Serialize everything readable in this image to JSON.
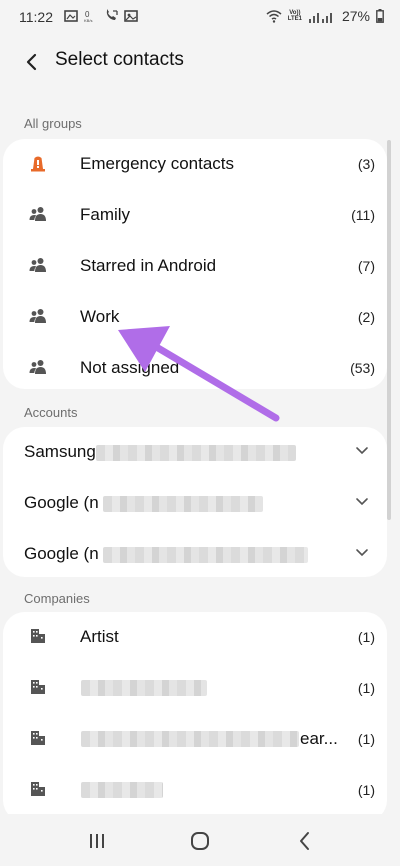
{
  "status_bar": {
    "time": "11:22",
    "volte": "Vo))",
    "lte": "LTE1",
    "battery": "27%"
  },
  "header": {
    "title": "Select contacts"
  },
  "sections": {
    "all_groups": "All groups",
    "accounts": "Accounts",
    "companies": "Companies"
  },
  "groups": [
    {
      "label": "Emergency contacts",
      "count": "(3)",
      "icon": "emergency-icon"
    },
    {
      "label": "Family",
      "count": "(11)",
      "icon": "group-icon"
    },
    {
      "label": "Starred in Android",
      "count": "(7)",
      "icon": "group-icon"
    },
    {
      "label": "Work",
      "count": "(2)",
      "icon": "group-icon"
    },
    {
      "label": "Not assigned",
      "count": "(53)",
      "icon": "group-icon"
    }
  ],
  "accounts": [
    {
      "label": "Samsung"
    },
    {
      "label": "Google (n"
    },
    {
      "label": "Google (n"
    }
  ],
  "companies": [
    {
      "label": "Artist",
      "count": "(1)"
    },
    {
      "label": "",
      "count": "(1)"
    },
    {
      "label": "ear...",
      "count": "(1)"
    },
    {
      "label": "",
      "count": "(1)"
    }
  ],
  "colors": {
    "accent_arrow": "#b06de8",
    "emergency": "#e86a2a",
    "icon_gray": "#555555"
  }
}
